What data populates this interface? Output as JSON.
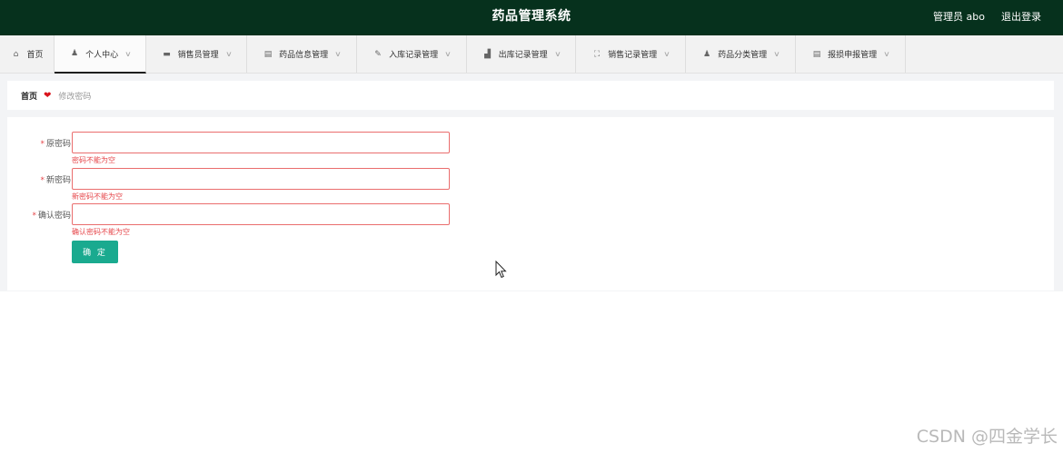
{
  "header": {
    "title": "药品管理系统",
    "user_label": "管理员 abo",
    "logout_label": "退出登录"
  },
  "nav": {
    "items": [
      {
        "label": "首页",
        "icon": "home-icon",
        "glyph": "⌂",
        "dropdown": false,
        "active": false
      },
      {
        "label": "个人中心",
        "icon": "user-icon",
        "glyph": "👤",
        "dropdown": true,
        "active": true
      },
      {
        "label": "销售员管理",
        "icon": "monitor-icon",
        "glyph": "▬",
        "dropdown": true,
        "active": false
      },
      {
        "label": "药品信息管理",
        "icon": "clipboard-icon",
        "glyph": "▤",
        "dropdown": true,
        "active": false
      },
      {
        "label": "入库记录管理",
        "icon": "edit-icon",
        "glyph": "✎",
        "dropdown": true,
        "active": false
      },
      {
        "label": "出库记录管理",
        "icon": "chart-icon",
        "glyph": "▟",
        "dropdown": true,
        "active": false
      },
      {
        "label": "销售记录管理",
        "icon": "fullscreen-icon",
        "glyph": "⛶",
        "dropdown": true,
        "active": false
      },
      {
        "label": "药品分类管理",
        "icon": "person-icon",
        "glyph": "♟",
        "dropdown": true,
        "active": false
      },
      {
        "label": "报损申报管理",
        "icon": "report-icon",
        "glyph": "▤",
        "dropdown": true,
        "active": false
      }
    ]
  },
  "breadcrumb": {
    "home": "首页",
    "separator_icon": "heart-icon",
    "separator_glyph": "❤",
    "current": "修改密码"
  },
  "form": {
    "required_mark": "*",
    "fields": [
      {
        "label": "原密码",
        "value": "",
        "error": "密码不能为空"
      },
      {
        "label": "新密码",
        "value": "",
        "error": "新密码不能为空"
      },
      {
        "label": "确认密码",
        "value": "",
        "error": "确认密码不能为空"
      }
    ],
    "submit_label": "确 定"
  },
  "watermark": "CSDN @四金学长",
  "colors": {
    "header_bg": "#06311d",
    "accent": "#1aaa8f",
    "error": "#e6474b",
    "heart": "#d9141c"
  }
}
